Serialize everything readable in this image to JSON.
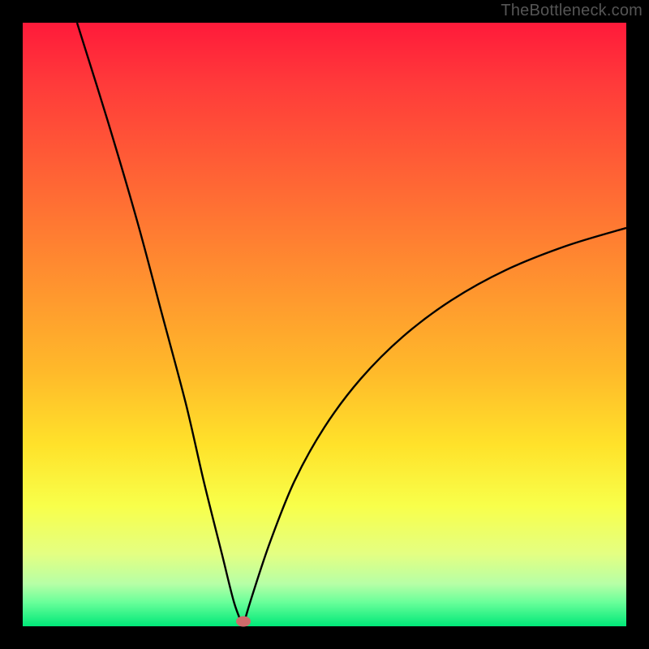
{
  "attribution": "TheBottleneck.com",
  "colors": {
    "curve_stroke": "#000000",
    "marker_fill": "#cf6b6b",
    "frame_bg": "#000000"
  },
  "chart_data": {
    "type": "line",
    "title": "",
    "xlabel": "",
    "ylabel": "",
    "xlim": [
      0,
      100
    ],
    "ylim": [
      0,
      100
    ],
    "grid": false,
    "legend": false,
    "series": [
      {
        "name": "left-branch",
        "x": [
          9,
          14,
          19,
          23,
          27,
          30,
          33,
          35,
          36.5
        ],
        "y": [
          100,
          84,
          67,
          52,
          37,
          24,
          12,
          4,
          0
        ]
      },
      {
        "name": "right-branch",
        "x": [
          36.5,
          38,
          41,
          45,
          50,
          56,
          63,
          71,
          80,
          90,
          100
        ],
        "y": [
          0,
          5,
          14,
          24,
          33,
          41,
          48,
          54,
          59,
          63,
          66
        ]
      }
    ],
    "annotations": [
      {
        "name": "vertex-marker",
        "x": 36.5,
        "y": 0.8
      }
    ]
  }
}
